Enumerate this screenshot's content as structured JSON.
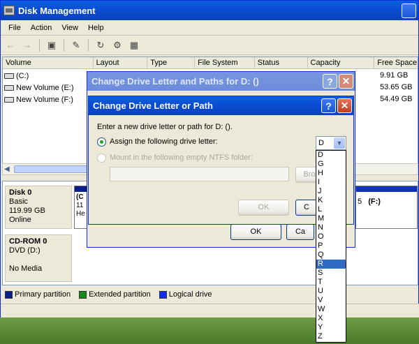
{
  "window": {
    "title": "Disk Management"
  },
  "menu": [
    "File",
    "Action",
    "View",
    "Help"
  ],
  "columns": [
    "Volume",
    "Layout",
    "Type",
    "File System",
    "Status",
    "Capacity",
    "Free Space"
  ],
  "volumes": [
    {
      "name": "(C:)",
      "free": "9.91 GB"
    },
    {
      "name": "New Volume (E:)",
      "free": "53.65 GB"
    },
    {
      "name": "New Volume (F:)",
      "free": "54.49 GB"
    }
  ],
  "disk0": {
    "name": "Disk 0",
    "type": "Basic",
    "size": "119.99 GB",
    "status": "Online",
    "part1_label": "(C",
    "part1_line2": "11",
    "part1_line3": "He",
    "part_f_label": "(F:)",
    "part_f_extra": "5"
  },
  "cdrom": {
    "name": "CD-ROM 0",
    "drive": "DVD (D:)",
    "media": "No Media"
  },
  "legend": {
    "primary": "Primary partition",
    "extended": "Extended partition",
    "logical": "Logical drive",
    "colors": {
      "primary": "#0a1e8a",
      "extended": "#1a8a1a",
      "logical": "#1030ee"
    }
  },
  "dialog_outer": {
    "title": "Change Drive Letter and Paths for D: ()",
    "ok": "OK",
    "cancel": "Ca"
  },
  "dialog_inner": {
    "title": "Change Drive Letter or Path",
    "prompt": "Enter a new drive letter or path for D: ().",
    "assign_label": "Assign the following drive letter:",
    "mount_label": "Mount in the following empty NTFS folder:",
    "browse": "Bro",
    "ok": "OK",
    "cancel": "C",
    "selected": "D"
  },
  "drive_letters": [
    "D",
    "G",
    "H",
    "I",
    "J",
    "K",
    "L",
    "M",
    "N",
    "O",
    "P",
    "Q",
    "R",
    "S",
    "T",
    "U",
    "V",
    "W",
    "X",
    "Y",
    "Z"
  ],
  "highlighted_letter": "R"
}
